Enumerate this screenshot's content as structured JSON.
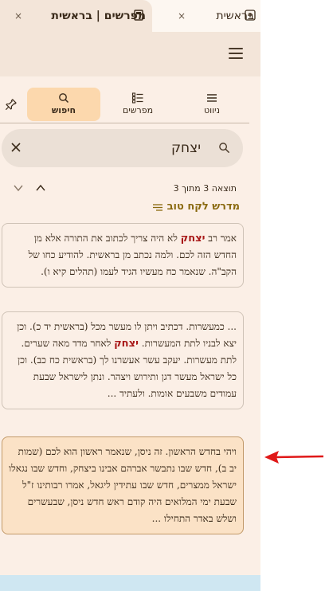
{
  "tabs": [
    {
      "label": "מפרשים | בראשית",
      "close": "×",
      "icon": "book-icon",
      "active": true
    },
    {
      "label": "בראשית",
      "close": "×",
      "icon": "new-tab-icon",
      "active": false
    }
  ],
  "panel": {
    "tabs": [
      {
        "label": "ניווט",
        "icon": "list-icon"
      },
      {
        "label": "מפרשים",
        "icon": "commentaries-icon"
      },
      {
        "label": "חיפוש",
        "icon": "search-icon",
        "active": true
      }
    ]
  },
  "search": {
    "value": "יצחק",
    "clear": "×"
  },
  "results": {
    "count_text": "תוצאה 3 מתוך 3"
  },
  "group": {
    "title": "מדרש לקח טוב"
  },
  "cards": [
    {
      "before": "אמר רב ",
      "highlight": "יצחק",
      "after": " לא היה צריך לכתוב את התורה אלא מן החדש הזה לכם. ולמה נכתב מן בראשית. להודיע כחו של הקב\"ה. שנאמר כח מעשיו הגיד לעמו (תהלים קיא ו).",
      "selected": false
    },
    {
      "before": "... כמעשרות. דכתיב ויתן לו מעשר מכל (בראשית יד כ). וכן יצא לבניו לתת המעשרות. ",
      "highlight": "יצחק",
      "after": " לאחר מדד מאה שערים. לתת מעשרות. יעקב עשר אעשרנו לך (בראשית כח כב). וכן כל ישראל מעשר דגן ותירוש ויצהר. ונתן לישראל שבעת עמודים משבעים אומות. ולעתיד ...",
      "selected": false
    },
    {
      "before": "",
      "highlight": "",
      "after": "ויהי בחדש הראשון. זה ניסן, שנאמר ראשון הוא לכם (שמות יב ב), חדש שבו נתבשר אברהם אבינו ביצחק, וחדש שבו נגאלו ישראל ממצרים, חדש שבו עתידין ליגאל, אמרו רבותינו ז\"ל שבעת ימי המלואים היה קודם ראש חדש ניסן, שבעשרים ושלש באדר התחילו ...",
      "selected": true
    }
  ],
  "annotation": {
    "color": "#e01818"
  }
}
